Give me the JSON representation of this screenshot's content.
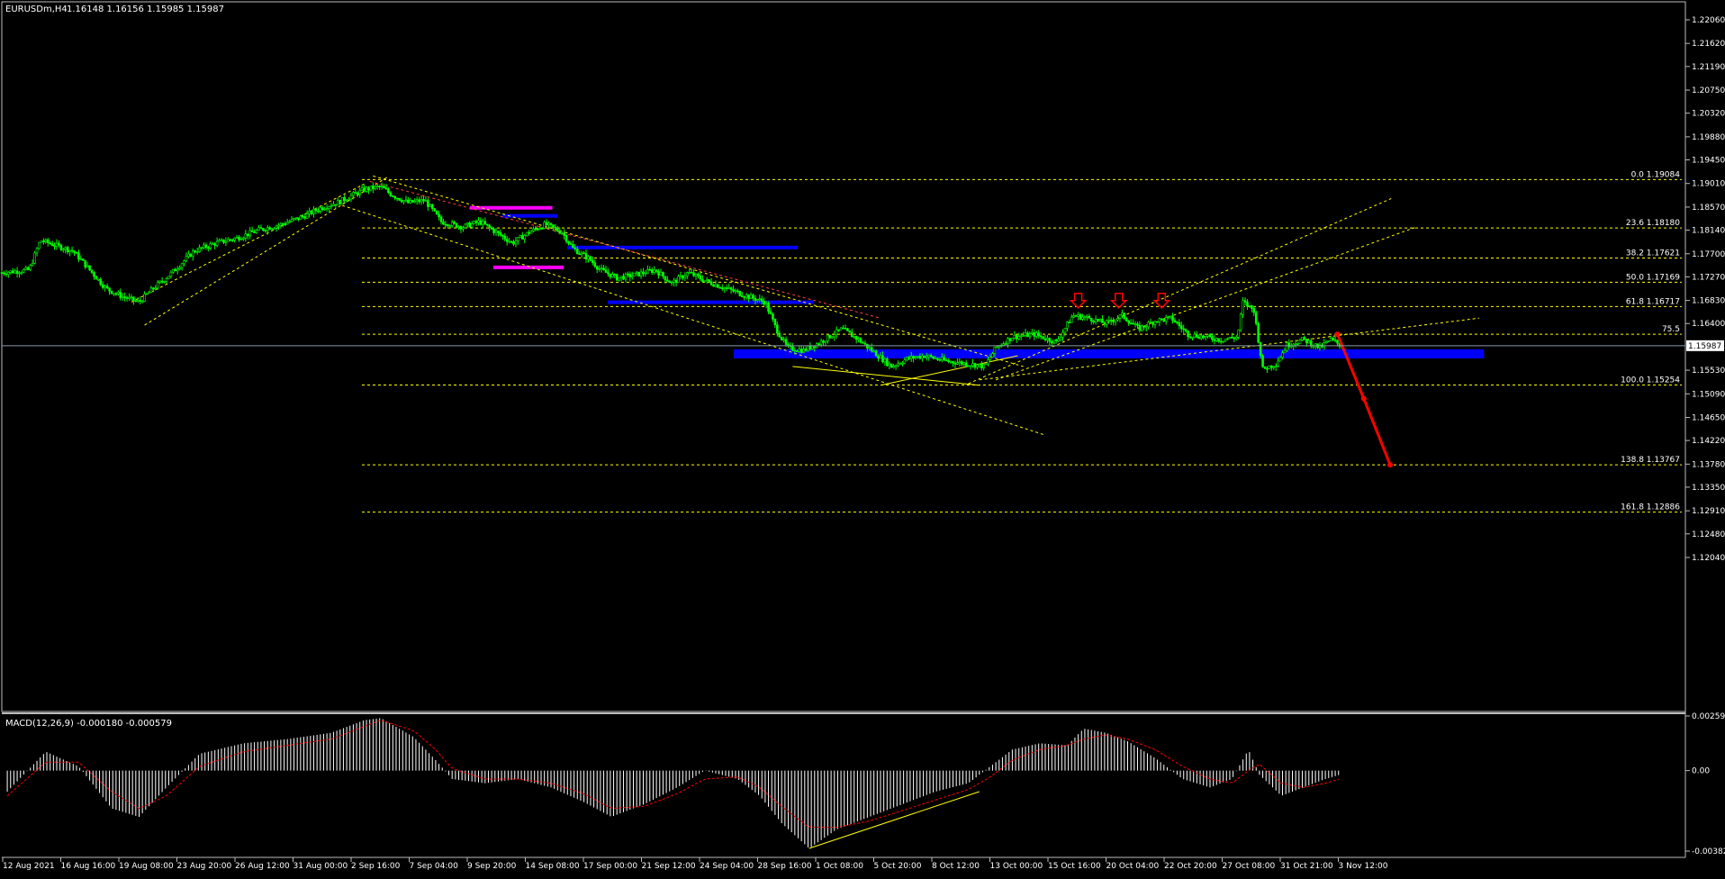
{
  "header": {
    "symbol": "EURUSDm,H4",
    "ohlc": "1.16148 1.16156 1.15985 1.15987"
  },
  "macd_label": "MACD(12,26,9) -0.000180 -0.000579",
  "current_price_label": "1.15987",
  "colors": {
    "background": "#000000",
    "candle": "#00ff00",
    "grid_line": "#ffff00",
    "zone": "#0000ff",
    "magenta": "#ff00ff",
    "arrow": "#ff0000",
    "macd_hist": "#ffffff",
    "macd_signal": "#ff0000"
  },
  "chart_data": [
    {
      "type": "line",
      "name_on_chart": "EURUSDm,H4",
      "y_axis_ticks": [
        "1.22060",
        "1.21620",
        "1.21190",
        "1.20750",
        "1.20320",
        "1.19880",
        "1.19450",
        "1.19010",
        "1.18570",
        "1.18140",
        "1.17700",
        "1.17270",
        "1.16830",
        "1.16400",
        "1.15530",
        "1.15090",
        "1.14650",
        "1.14220",
        "1.13780",
        "1.13350",
        "1.12910",
        "1.12480",
        "1.12040"
      ],
      "x_axis_ticks": [
        "12 Aug 2021",
        "16 Aug 16:00",
        "19 Aug 08:00",
        "23 Aug 20:00",
        "26 Aug 12:00",
        "31 Aug 00:00",
        "2 Sep 16:00",
        "7 Sep 04:00",
        "9 Sep 20:00",
        "14 Sep 08:00",
        "17 Sep 00:00",
        "21 Sep 12:00",
        "24 Sep 04:00",
        "28 Sep 16:00",
        "1 Oct 08:00",
        "5 Oct 20:00",
        "8 Oct 12:00",
        "13 Oct 00:00",
        "15 Oct 16:00",
        "20 Oct 04:00",
        "22 Oct 20:00",
        "27 Oct 08:00",
        "31 Oct 21:00",
        "3 Nov 12:00"
      ],
      "ylim": [
        1.1191,
        1.225
      ],
      "price_path": [
        [
          0,
          1.1735
        ],
        [
          25,
          1.174
        ],
        [
          35,
          1.1795
        ],
        [
          50,
          1.1785
        ],
        [
          65,
          1.1775
        ],
        [
          80,
          1.174
        ],
        [
          95,
          1.1705
        ],
        [
          110,
          1.169
        ],
        [
          125,
          1.168
        ],
        [
          135,
          1.17
        ],
        [
          155,
          1.1735
        ],
        [
          175,
          1.1775
        ],
        [
          195,
          1.179
        ],
        [
          215,
          1.18
        ],
        [
          235,
          1.1815
        ],
        [
          255,
          1.1825
        ],
        [
          275,
          1.184
        ],
        [
          290,
          1.1855
        ],
        [
          305,
          1.1865
        ],
        [
          315,
          1.1875
        ],
        [
          330,
          1.189
        ],
        [
          345,
          1.1895
        ],
        [
          355,
          1.188
        ],
        [
          370,
          1.1865
        ],
        [
          385,
          1.187
        ],
        [
          400,
          1.183
        ],
        [
          420,
          1.182
        ],
        [
          435,
          1.183
        ],
        [
          450,
          1.181
        ],
        [
          465,
          1.179
        ],
        [
          480,
          1.181
        ],
        [
          495,
          1.1825
        ],
        [
          510,
          1.181
        ],
        [
          520,
          1.178
        ],
        [
          535,
          1.176
        ],
        [
          545,
          1.174
        ],
        [
          560,
          1.1725
        ],
        [
          575,
          1.173
        ],
        [
          595,
          1.174
        ],
        [
          610,
          1.1715
        ],
        [
          625,
          1.1735
        ],
        [
          640,
          1.172
        ],
        [
          660,
          1.1705
        ],
        [
          680,
          1.169
        ],
        [
          695,
          1.168
        ],
        [
          705,
          1.163
        ],
        [
          715,
          1.1595
        ],
        [
          730,
          1.159
        ],
        [
          745,
          1.1605
        ],
        [
          765,
          1.163
        ],
        [
          780,
          1.161
        ],
        [
          795,
          1.1585
        ],
        [
          810,
          1.156
        ],
        [
          825,
          1.1575
        ],
        [
          840,
          1.158
        ],
        [
          860,
          1.157
        ],
        [
          880,
          1.1565
        ],
        [
          895,
          1.156
        ],
        [
          905,
          1.1595
        ],
        [
          920,
          1.1615
        ],
        [
          940,
          1.162
        ],
        [
          960,
          1.1605
        ],
        [
          975,
          1.1655
        ],
        [
          990,
          1.165
        ],
        [
          1005,
          1.164
        ],
        [
          1020,
          1.1655
        ],
        [
          1035,
          1.163
        ],
        [
          1050,
          1.1645
        ],
        [
          1065,
          1.165
        ],
        [
          1080,
          1.162
        ],
        [
          1095,
          1.1615
        ],
        [
          1110,
          1.161
        ],
        [
          1125,
          1.1615
        ],
        [
          1130,
          1.168
        ],
        [
          1140,
          1.1665
        ],
        [
          1148,
          1.1555
        ],
        [
          1160,
          1.1565
        ],
        [
          1170,
          1.16
        ],
        [
          1185,
          1.161
        ],
        [
          1200,
          1.1595
        ],
        [
          1210,
          1.161
        ],
        [
          1220,
          1.15987
        ]
      ]
    },
    {
      "type": "bar",
      "name_on_chart": "MACD(12,26,9)",
      "y_axis_ticks": [
        "0.002598",
        "0.00",
        "-0.003829"
      ],
      "ylim": [
        -0.003829,
        0.002598
      ],
      "histogram": [
        [
          5,
          -0.001
        ],
        [
          40,
          0.0009
        ],
        [
          70,
          0.0002
        ],
        [
          100,
          -0.0018
        ],
        [
          125,
          -0.0022
        ],
        [
          150,
          -0.0008
        ],
        [
          180,
          0.0008
        ],
        [
          220,
          0.0013
        ],
        [
          260,
          0.0015
        ],
        [
          300,
          0.0018
        ],
        [
          330,
          0.0024
        ],
        [
          345,
          0.0025
        ],
        [
          375,
          0.0016
        ],
        [
          395,
          0.0005
        ],
        [
          410,
          -0.0004
        ],
        [
          440,
          -0.0006
        ],
        [
          470,
          -0.0004
        ],
        [
          500,
          -0.0008
        ],
        [
          530,
          -0.0015
        ],
        [
          555,
          -0.0022
        ],
        [
          585,
          -0.0016
        ],
        [
          615,
          -0.0008
        ],
        [
          640,
          0.0
        ],
        [
          670,
          -0.0004
        ],
        [
          690,
          -0.0012
        ],
        [
          710,
          -0.0025
        ],
        [
          735,
          -0.0037
        ],
        [
          760,
          -0.0028
        ],
        [
          790,
          -0.0022
        ],
        [
          820,
          -0.0016
        ],
        [
          850,
          -0.001
        ],
        [
          880,
          -0.0006
        ],
        [
          900,
          0.0002
        ],
        [
          920,
          0.001
        ],
        [
          945,
          0.0013
        ],
        [
          970,
          0.0012
        ],
        [
          985,
          0.002
        ],
        [
          1005,
          0.0018
        ],
        [
          1025,
          0.0014
        ],
        [
          1050,
          0.0006
        ],
        [
          1075,
          -0.0004
        ],
        [
          1100,
          -0.0008
        ],
        [
          1120,
          -0.0004
        ],
        [
          1135,
          0.001
        ],
        [
          1145,
          -0.0002
        ],
        [
          1165,
          -0.0012
        ],
        [
          1185,
          -0.0008
        ],
        [
          1205,
          -0.0004
        ],
        [
          1218,
          -0.0002
        ]
      ],
      "signal": [
        [
          5,
          -0.0012
        ],
        [
          40,
          0.0004
        ],
        [
          70,
          0.0004
        ],
        [
          100,
          -0.001
        ],
        [
          125,
          -0.0018
        ],
        [
          150,
          -0.0012
        ],
        [
          180,
          0.0002
        ],
        [
          220,
          0.0009
        ],
        [
          260,
          0.0012
        ],
        [
          300,
          0.0015
        ],
        [
          330,
          0.0021
        ],
        [
          345,
          0.0024
        ],
        [
          375,
          0.0019
        ],
        [
          395,
          0.001
        ],
        [
          410,
          0.0001
        ],
        [
          440,
          -0.0004
        ],
        [
          470,
          -0.0004
        ],
        [
          500,
          -0.0006
        ],
        [
          530,
          -0.0011
        ],
        [
          555,
          -0.0018
        ],
        [
          585,
          -0.0017
        ],
        [
          615,
          -0.0011
        ],
        [
          640,
          -0.0004
        ],
        [
          670,
          -0.0003
        ],
        [
          690,
          -0.0008
        ],
        [
          710,
          -0.0017
        ],
        [
          735,
          -0.0027
        ],
        [
          760,
          -0.0027
        ],
        [
          790,
          -0.0024
        ],
        [
          820,
          -0.0019
        ],
        [
          850,
          -0.0014
        ],
        [
          880,
          -0.0009
        ],
        [
          900,
          -0.0003
        ],
        [
          920,
          0.0005
        ],
        [
          945,
          0.001
        ],
        [
          970,
          0.0012
        ],
        [
          985,
          0.0015
        ],
        [
          1005,
          0.0017
        ],
        [
          1025,
          0.0015
        ],
        [
          1050,
          0.001
        ],
        [
          1075,
          0.0002
        ],
        [
          1100,
          -0.0004
        ],
        [
          1120,
          -0.0006
        ],
        [
          1135,
          0.0
        ],
        [
          1145,
          0.0003
        ],
        [
          1165,
          -0.0006
        ],
        [
          1185,
          -0.0008
        ],
        [
          1205,
          -0.0006
        ],
        [
          1218,
          -0.0004
        ]
      ]
    }
  ],
  "fibonacci_levels": [
    {
      "label": "0.0 1.19084",
      "price": 1.19084
    },
    {
      "label": "23.6 1.18180",
      "price": 1.1818
    },
    {
      "label": "38.2 1.17621",
      "price": 1.17621
    },
    {
      "label": "50.0 1.17169",
      "price": 1.17169
    },
    {
      "label": "61.8 1.16717",
      "price": 1.16717
    },
    {
      "label": "75.5",
      "price": 1.162
    },
    {
      "label": "100.0 1.15254",
      "price": 1.15254
    },
    {
      "label": "138.8 1.13767",
      "price": 1.13767
    },
    {
      "label": "161.8 1.12886",
      "price": 1.12886
    }
  ],
  "zones": [
    {
      "color": "#0000ff",
      "x1": 665,
      "x2": 1348,
      "p1": 1.1575,
      "p2": 1.1592
    },
    {
      "color": "#0000ff",
      "x1": 530,
      "x2": 740,
      "p1": 1.178,
      "p2": 1.1785
    },
    {
      "color": "#0000ff",
      "x1": 575,
      "x2": 762,
      "p1": 1.1678,
      "p2": 1.1683
    },
    {
      "color": "#0000ff",
      "x1": 458,
      "x2": 508,
      "p1": 1.184,
      "p2": 1.1844
    },
    {
      "color": "#ff00ff",
      "x1": 422,
      "x2": 497,
      "p1": 1.1856,
      "p2": 1.1859
    },
    {
      "color": "#ff00ff",
      "x1": 448,
      "x2": 512,
      "p1": 1.1745,
      "p2": 1.1748
    }
  ],
  "trendlines": [
    {
      "color": "#ffff00",
      "dash": true,
      "x1": 130,
      "p1": 1.1637,
      "x2": 352,
      "p2": 1.1914
    },
    {
      "color": "#ffff00",
      "dash": true,
      "x1": 118,
      "p1": 1.168,
      "x2": 330,
      "p2": 1.19
    },
    {
      "color": "#ffff00",
      "dash": true,
      "x1": 338,
      "p1": 1.1915,
      "x2": 930,
      "p2": 1.156
    },
    {
      "color": "#ffff00",
      "dash": true,
      "x1": 310,
      "p1": 1.186,
      "x2": 950,
      "p2": 1.1432
    },
    {
      "color": "#ff4040",
      "dash": true,
      "x1": 335,
      "p1": 1.1905,
      "x2": 800,
      "p2": 1.165
    },
    {
      "color": "#ffff00",
      "dash": true,
      "x1": 880,
      "p1": 1.1528,
      "x2": 1265,
      "p2": 1.1873
    },
    {
      "color": "#ffff00",
      "dash": true,
      "x1": 905,
      "p1": 1.1535,
      "x2": 1288,
      "p2": 1.182
    },
    {
      "color": "#ffff00",
      "dash": true,
      "x1": 890,
      "p1": 1.1535,
      "x2": 1345,
      "p2": 1.165
    },
    {
      "color": "#ffff00",
      "dash": false,
      "x1": 720,
      "p1": 1.156,
      "x2": 890,
      "p2": 1.1525
    },
    {
      "color": "#ffff00",
      "dash": false,
      "x1": 800,
      "p1": 1.1525,
      "x2": 925,
      "p2": 1.158
    }
  ],
  "down_arrows": [
    {
      "x": 980,
      "price": 1.1676
    },
    {
      "x": 1017,
      "price": 1.1676
    },
    {
      "x": 1056,
      "price": 1.1676
    }
  ],
  "projection": [
    {
      "x": 1216,
      "price": 1.162
    },
    {
      "x": 1240,
      "price": 1.15
    },
    {
      "x": 1264,
      "price": 1.13767
    }
  ],
  "macd_divergence": [
    {
      "x": 735,
      "value": -0.0037
    },
    {
      "x": 890,
      "value": -0.001
    }
  ]
}
